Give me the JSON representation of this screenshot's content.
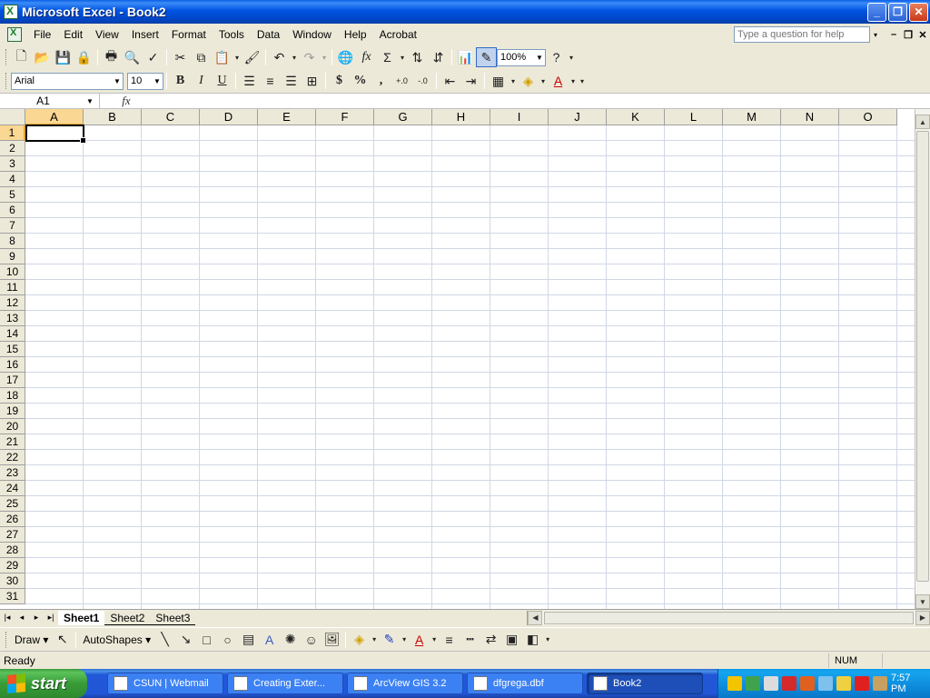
{
  "window": {
    "title": "Microsoft Excel - Book2",
    "minimize": "_",
    "restore": "❐",
    "close": "✕"
  },
  "menu": {
    "items": [
      "File",
      "Edit",
      "View",
      "Insert",
      "Format",
      "Tools",
      "Data",
      "Window",
      "Help",
      "Acrobat"
    ],
    "help_placeholder": "Type a question for help",
    "help_drop": "▾",
    "doc_min": "–",
    "doc_restore": "❐",
    "doc_close": "✕"
  },
  "standard_toolbar": {
    "zoom": "100%"
  },
  "formatting_toolbar": {
    "font": "Arial",
    "size": "10",
    "bold": "B",
    "italic": "I",
    "underline": "U",
    "currency": "$",
    "percent": "%",
    "comma": ","
  },
  "formula_bar": {
    "name_box": "A1",
    "fx": "fx",
    "value": ""
  },
  "grid": {
    "columns": [
      "A",
      "B",
      "C",
      "D",
      "E",
      "F",
      "G",
      "H",
      "I",
      "J",
      "K",
      "L",
      "M",
      "N",
      "O"
    ],
    "rows": [
      "1",
      "2",
      "3",
      "4",
      "5",
      "6",
      "7",
      "8",
      "9",
      "10",
      "11",
      "12",
      "13",
      "14",
      "15",
      "16",
      "17",
      "18",
      "19",
      "20",
      "21",
      "22",
      "23",
      "24",
      "25",
      "26",
      "27",
      "28",
      "29",
      "30",
      "31"
    ],
    "active_cell": "A1"
  },
  "sheet_tabs": [
    "Sheet1",
    "Sheet2",
    "Sheet3"
  ],
  "tab_nav": [
    "|◂",
    "◂",
    "▸",
    "▸|"
  ],
  "draw_toolbar": {
    "draw": "Draw ▾",
    "autoshapes": "AutoShapes ▾"
  },
  "status": {
    "ready": "Ready",
    "num": "NUM"
  },
  "taskbar": {
    "start": "start",
    "tasks": [
      "CSUN | Webmail",
      "Creating Exter...",
      "ArcView GIS 3.2",
      "dfgrega.dbf",
      "Book2"
    ],
    "active_task": "Book2",
    "clock": "7:57 PM"
  }
}
